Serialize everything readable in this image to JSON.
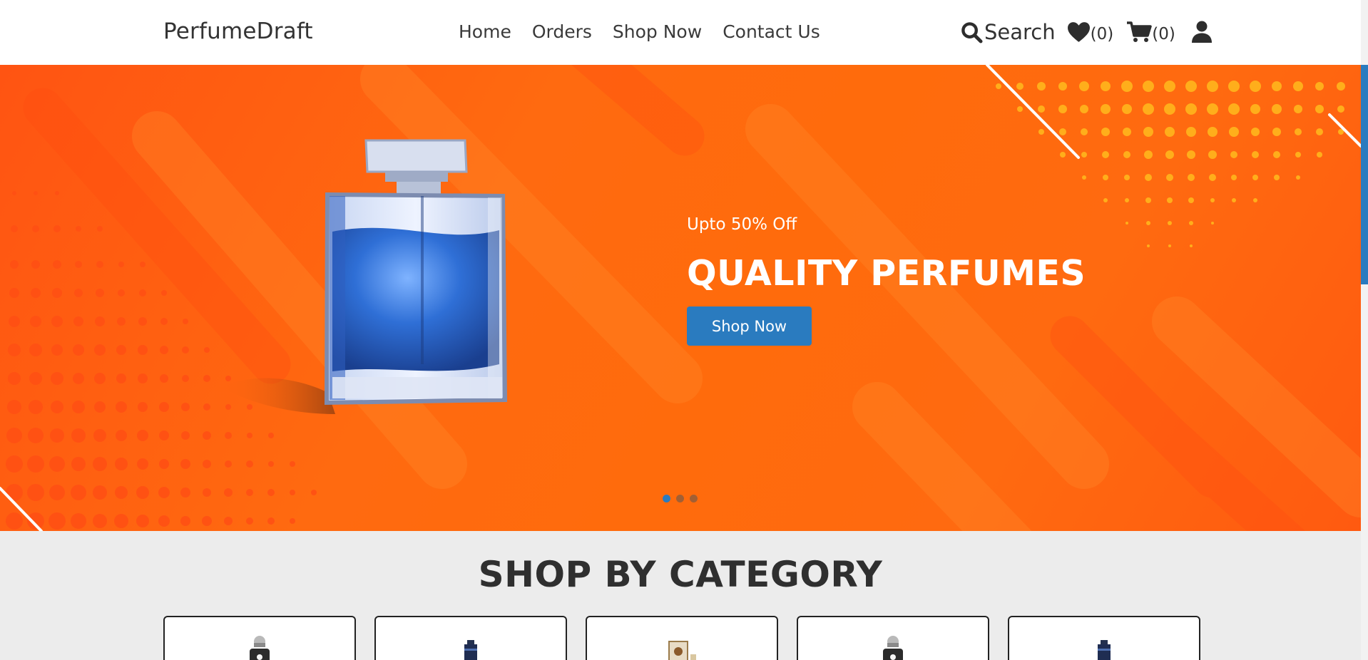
{
  "navbar": {
    "brand": "PerfumeDraft",
    "links": [
      "Home",
      "Orders",
      "Shop Now",
      "Contact Us"
    ],
    "search_label": "Search",
    "wishlist_count": "(0)",
    "cart_count": "(0)",
    "icons": {
      "search": "search-icon",
      "wishlist": "heart-icon",
      "cart": "cart-icon",
      "account": "user-icon"
    }
  },
  "hero": {
    "subtitle": "Upto 50% Off",
    "title": "QUALITY PERFUMES",
    "button_label": "Shop Now",
    "slides": 3,
    "active_slide": 1,
    "colors": {
      "background": "#ff6a10",
      "button": "#2a7bbf",
      "liquid": "#2f6fd6"
    }
  },
  "categories": {
    "heading": "SHOP BY CATEGORY",
    "cards": [
      {
        "image": "silver-cap-perfume"
      },
      {
        "image": "navy-bottle-perfume"
      },
      {
        "image": "gold-box-perfume"
      },
      {
        "image": "silver-cap-perfume"
      },
      {
        "image": "navy-bottle-perfume"
      }
    ]
  }
}
